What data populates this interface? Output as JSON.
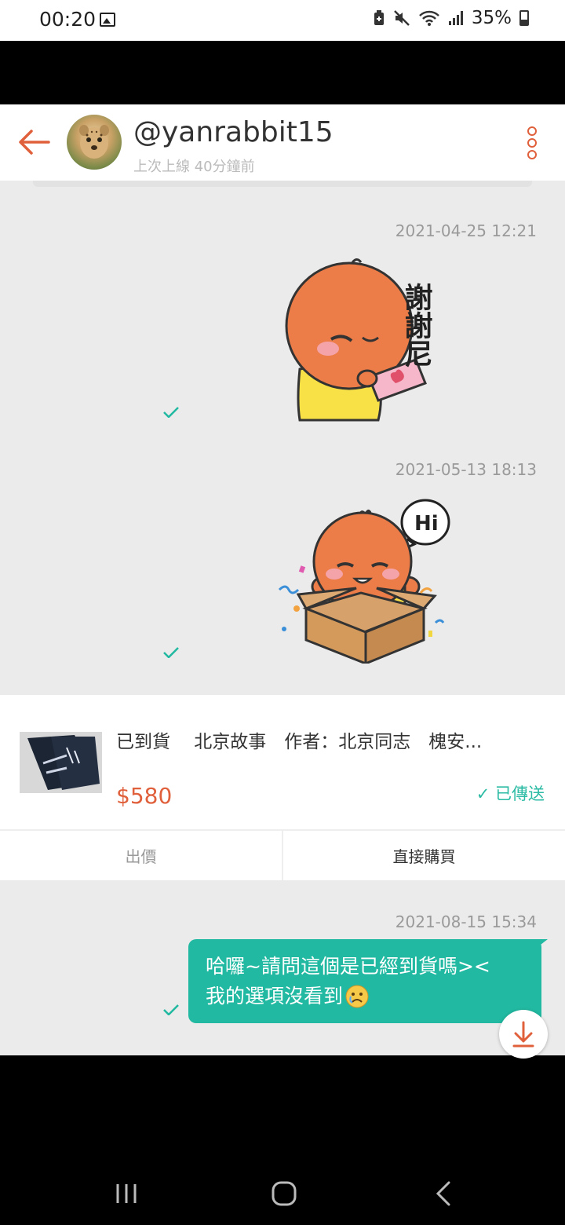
{
  "status": {
    "time": "00:20",
    "battery": "35%",
    "icons": [
      "gallery-icon",
      "battery-saver-icon",
      "mute-icon",
      "wifi-icon",
      "signal-icon",
      "battery-icon"
    ]
  },
  "header": {
    "username": "@yanrabbit15",
    "last_seen": "上次上線 40分鐘前"
  },
  "messages": [
    {
      "timestamp": "2021-04-25 12:21",
      "sticker_text": "謝謝尼"
    },
    {
      "timestamp": "2021-05-13 18:13",
      "sticker_text": "Hi"
    }
  ],
  "product": {
    "title": "已到貨　 北京故事　作者：北京同志　槐安...",
    "price": "$580",
    "status": "已傳送",
    "offer_label": "出價",
    "buy_label": "直接購買"
  },
  "message3": {
    "timestamp": "2021-08-15 15:34",
    "line1": "哈囉~請問這個是已經到貨嗎><",
    "line2": "我的選項沒看到"
  },
  "colors": {
    "accent": "#e0603c",
    "teal": "#21b9a1",
    "chat_bg": "#ebebeb"
  }
}
